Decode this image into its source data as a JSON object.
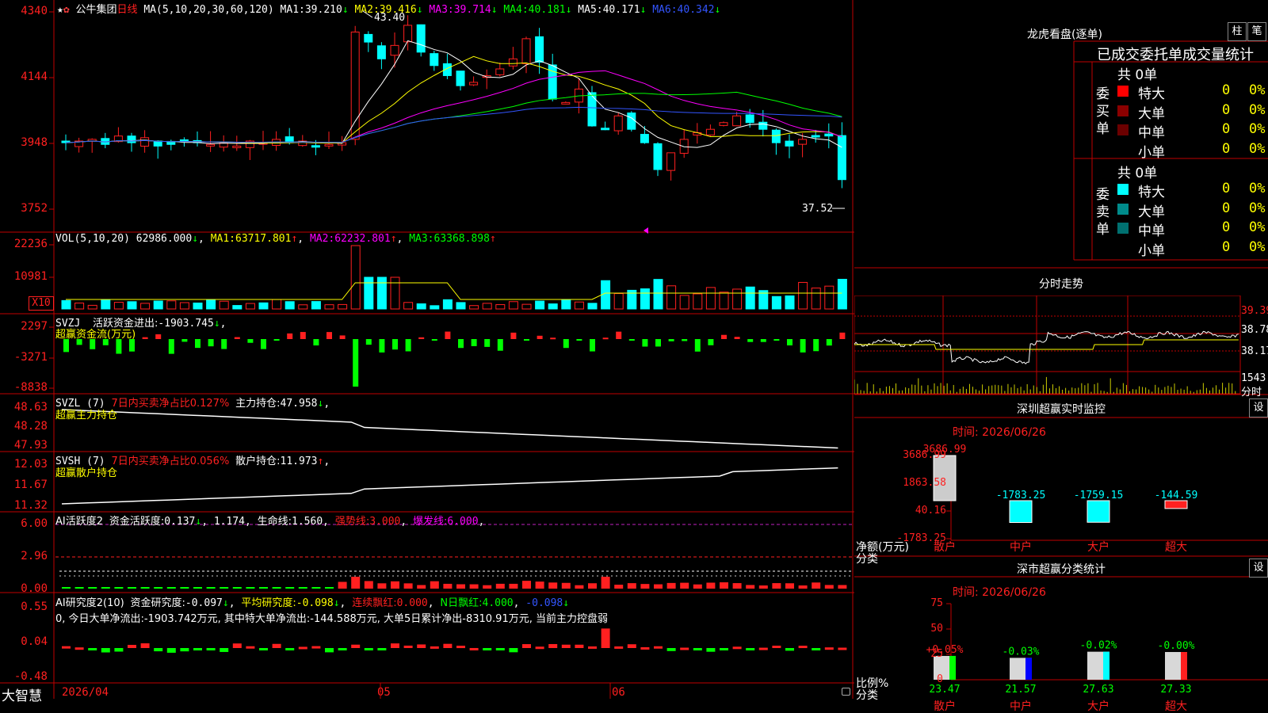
{
  "header": {
    "star": "★",
    "stock_name": "公牛集团",
    "period": "日线",
    "ma_label": "MA(5,10,20,30,60,120)",
    "ma_values": [
      {
        "label": "MA1:",
        "value": "39.210",
        "color": "#ffffff"
      },
      {
        "label": "MA2:",
        "value": "39.416",
        "color": "#ffff00"
      },
      {
        "label": "MA3:",
        "value": "39.714",
        "color": "#ff00ff"
      },
      {
        "label": "MA4:",
        "value": "40.181",
        "color": "#00ff00"
      },
      {
        "label": "MA5:",
        "value": "40.171",
        "color": "#ffffff"
      },
      {
        "label": "MA6:",
        "value": "40.342",
        "color": "#3355ff"
      }
    ],
    "high_mark": "43.40",
    "low_mark": "37.52"
  },
  "price_axis": [
    "4340",
    "4144",
    "3948",
    "3752"
  ],
  "vol": {
    "title": "VOL(5,10,20)",
    "value": "62986.000",
    "ma1_label": "MA1:",
    "ma1": "63717.801",
    "ma2_label": "MA2:",
    "ma2": "62232.801",
    "ma3_label": "MA3:",
    "ma3": "63368.898",
    "axis": [
      "22236",
      "10981",
      "X10"
    ]
  },
  "svzj": {
    "line1_a": "SVZJ",
    "line1_b": "活跃资金进出:",
    "line1_c": "-1903.745",
    "line2": "超赢资金流(万元)",
    "axis": [
      "2297",
      "-3271",
      "-8838"
    ]
  },
  "svzl": {
    "line1_a": "SVZL (7)",
    "line1_b": "7日内买卖净占比0.127%",
    "line1_c": "主力持仓:",
    "line1_d": "47.958",
    "line2": "超赢主力持仓",
    "axis": [
      "48.63",
      "48.28",
      "47.93"
    ]
  },
  "svsh": {
    "line1_a": "SVSH (7)",
    "line1_b": "7日内买卖净占比0.056%",
    "line1_c": "散户持仓:",
    "line1_d": "11.973",
    "line2": "超赢散户持仓",
    "axis": [
      "12.03",
      "11.67",
      "11.32"
    ]
  },
  "ai_active": {
    "title": "AI活跃度2",
    "a": "资金活跃度:",
    "a_val": "0.137",
    "b_val": "1.174",
    "c": "生命线:",
    "c_val": "1.560",
    "d": "强势线:",
    "d_val": "3.000",
    "e": "爆发线:",
    "e_val": "6.000",
    "axis": [
      "6.00",
      "2.96",
      "0.00"
    ]
  },
  "ai_research": {
    "title": "AI研究度2(10)",
    "a": "资金研究度:",
    "a_val": "-0.097",
    "b": "平均研究度:",
    "b_val": "-0.098",
    "c": "连续飘红:",
    "c_val": "0.000",
    "d": "N日飘红:",
    "d_val": "4.000",
    "e_val": "-0.098",
    "line2": "0, 今日大单净流出:-1903.742万元, 其中特大单净流出:-144.588万元, 大单5日累计净出-8310.91万元, 当前主力控盘弱",
    "axis": [
      "0.55",
      "0.04",
      "-0.48"
    ]
  },
  "x_axis": {
    "labels": [
      "2026/04",
      "05",
      "06"
    ],
    "brand": "大智慧"
  },
  "right": {
    "lhb_title": "龙虎看盘(逐单)",
    "btn1": "柱",
    "btn2": "笔",
    "order_title": "已成交委托单成交量统计",
    "buy_side": "委买单",
    "sell_side": "委卖单",
    "buy_total": "共 0单",
    "sell_total": "共 0单",
    "buy_rows": [
      {
        "label": "特大",
        "count": "0",
        "pct": "0%",
        "color": "#ff0000"
      },
      {
        "label": "大单",
        "count": "0",
        "pct": "0%",
        "color": "#8b0000"
      },
      {
        "label": "中单",
        "count": "0",
        "pct": "0%",
        "color": "#6b0000"
      },
      {
        "label": "小单",
        "count": "0",
        "pct": "0%",
        "color": ""
      }
    ],
    "sell_rows": [
      {
        "label": "特大",
        "count": "0",
        "pct": "0%",
        "color": "#00ffff"
      },
      {
        "label": "大单",
        "count": "0",
        "pct": "0%",
        "color": "#008b8b"
      },
      {
        "label": "中单",
        "count": "0",
        "pct": "0%",
        "color": "#007070"
      },
      {
        "label": "小单",
        "count": "0",
        "pct": "0%",
        "color": ""
      }
    ],
    "fs_title": "分时走势",
    "fs_axis": [
      "39.39",
      "38.78",
      "38.17"
    ],
    "fs_vol": "1543",
    "fs_unit": "分时",
    "sz_title": "深圳超赢实时监控",
    "sz_btn": "设",
    "sz_time": "时间: 2026/06/26",
    "sz_axis": [
      "3686.99",
      "1863.58",
      "40.16",
      "-1783.25"
    ],
    "sz_ylabel": "净额(万元)",
    "sz_xlabel": "分类",
    "sz_cats": [
      "散户",
      "中户",
      "大户",
      "超大"
    ],
    "sz_values": [
      "3686.99",
      "-1783.25",
      "-1759.15",
      "-144.59"
    ],
    "ss_title": "深市超赢分类统计",
    "ss_btn": "设",
    "ss_time": "时间: 2026/06/26",
    "ss_axis": [
      "75",
      "50",
      "25",
      "0"
    ],
    "ss_ylabel": "比例%",
    "ss_xlabel": "分类",
    "ss_cats": [
      "散户",
      "中户",
      "大户",
      "超大"
    ],
    "ss_pct": [
      "+0.05%",
      "-0.03%",
      "-0.02%",
      "-0.00%"
    ],
    "ss_values": [
      "23.47",
      "21.57",
      "27.63",
      "27.33"
    ]
  },
  "chart_data": [
    {
      "type": "bar",
      "title": "深圳超赢实时监控",
      "categories": [
        "散户",
        "中户",
        "大户",
        "超大"
      ],
      "values": [
        3686.99,
        -1783.25,
        -1759.15,
        -144.59
      ],
      "ylabel": "净额(万元)",
      "xlabel": "分类",
      "ylim": [
        -1783.25,
        3686.99
      ]
    },
    {
      "type": "bar",
      "title": "深市超赢分类统计",
      "categories": [
        "散户",
        "中户",
        "大户",
        "超大"
      ],
      "values": [
        23.47,
        21.57,
        27.63,
        27.33
      ],
      "ylabel": "比例%",
      "xlabel": "分类",
      "ylim": [
        0,
        75
      ]
    }
  ]
}
